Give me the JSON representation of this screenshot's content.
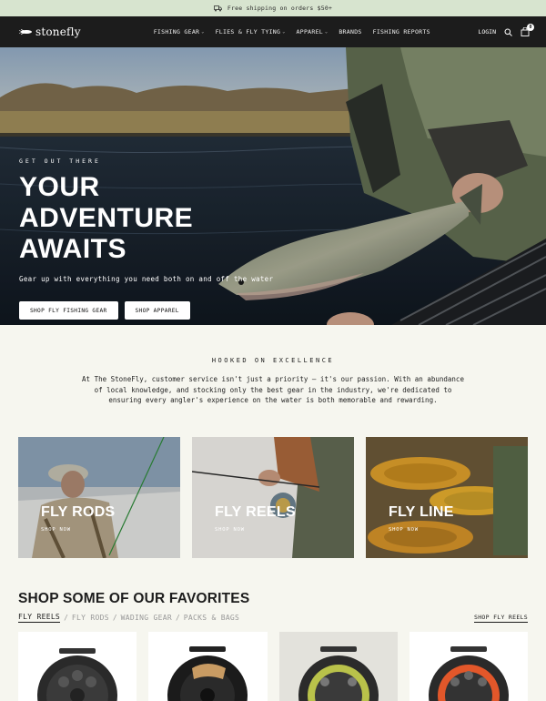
{
  "announcement": {
    "text": "Free shipping on orders $50+"
  },
  "header": {
    "logo_text": "stonefly",
    "nav": [
      {
        "label": "FISHING GEAR",
        "has_dropdown": true
      },
      {
        "label": "FLIES & FLY TYING",
        "has_dropdown": true
      },
      {
        "label": "APPAREL",
        "has_dropdown": true
      },
      {
        "label": "BRANDS",
        "has_dropdown": false
      },
      {
        "label": "FISHING REPORTS",
        "has_dropdown": false
      }
    ],
    "login_label": "LOGIN",
    "cart_count": "0"
  },
  "hero": {
    "eyebrow": "GET OUT THERE",
    "title": "YOUR ADVENTURE AWAITS",
    "subtitle": "Gear up with everything you need both on and off the water",
    "buttons": [
      "SHOP FLY FISHING GEAR",
      "SHOP APPAREL"
    ]
  },
  "intro": {
    "eyebrow": "HOOKED ON EXCELLENCE",
    "body": "At The StoneFly, customer service isn't just a priority — it's our passion. With an abundance of local knowledge, and stocking only the best gear in the industry, we're dedicated to ensuring every angler's experience on the water is both memorable and rewarding."
  },
  "collections": [
    {
      "title": "FLY RODS",
      "link": "SHOP NOW"
    },
    {
      "title": "FLY REELS",
      "link": "SHOP NOW"
    },
    {
      "title": "FLY LINE",
      "link": "SHOP NOW"
    }
  ],
  "favorites": {
    "title": "SHOP SOME OF OUR FAVORITES",
    "tabs": [
      "FLY REELS",
      "FLY RODS",
      "WADING GEAR",
      "PACKS & BAGS"
    ],
    "active_tab": "FLY REELS",
    "shop_link": "SHOP FLY REELS"
  },
  "colors": {
    "announcement_bg": "#d7e4cf",
    "header_bg": "#1c1c1c",
    "page_bg": "#f6f6ef"
  },
  "icons": [
    "truck-icon",
    "stonefly-logo-icon",
    "search-icon",
    "cart-icon",
    "chevron-down-icon"
  ]
}
